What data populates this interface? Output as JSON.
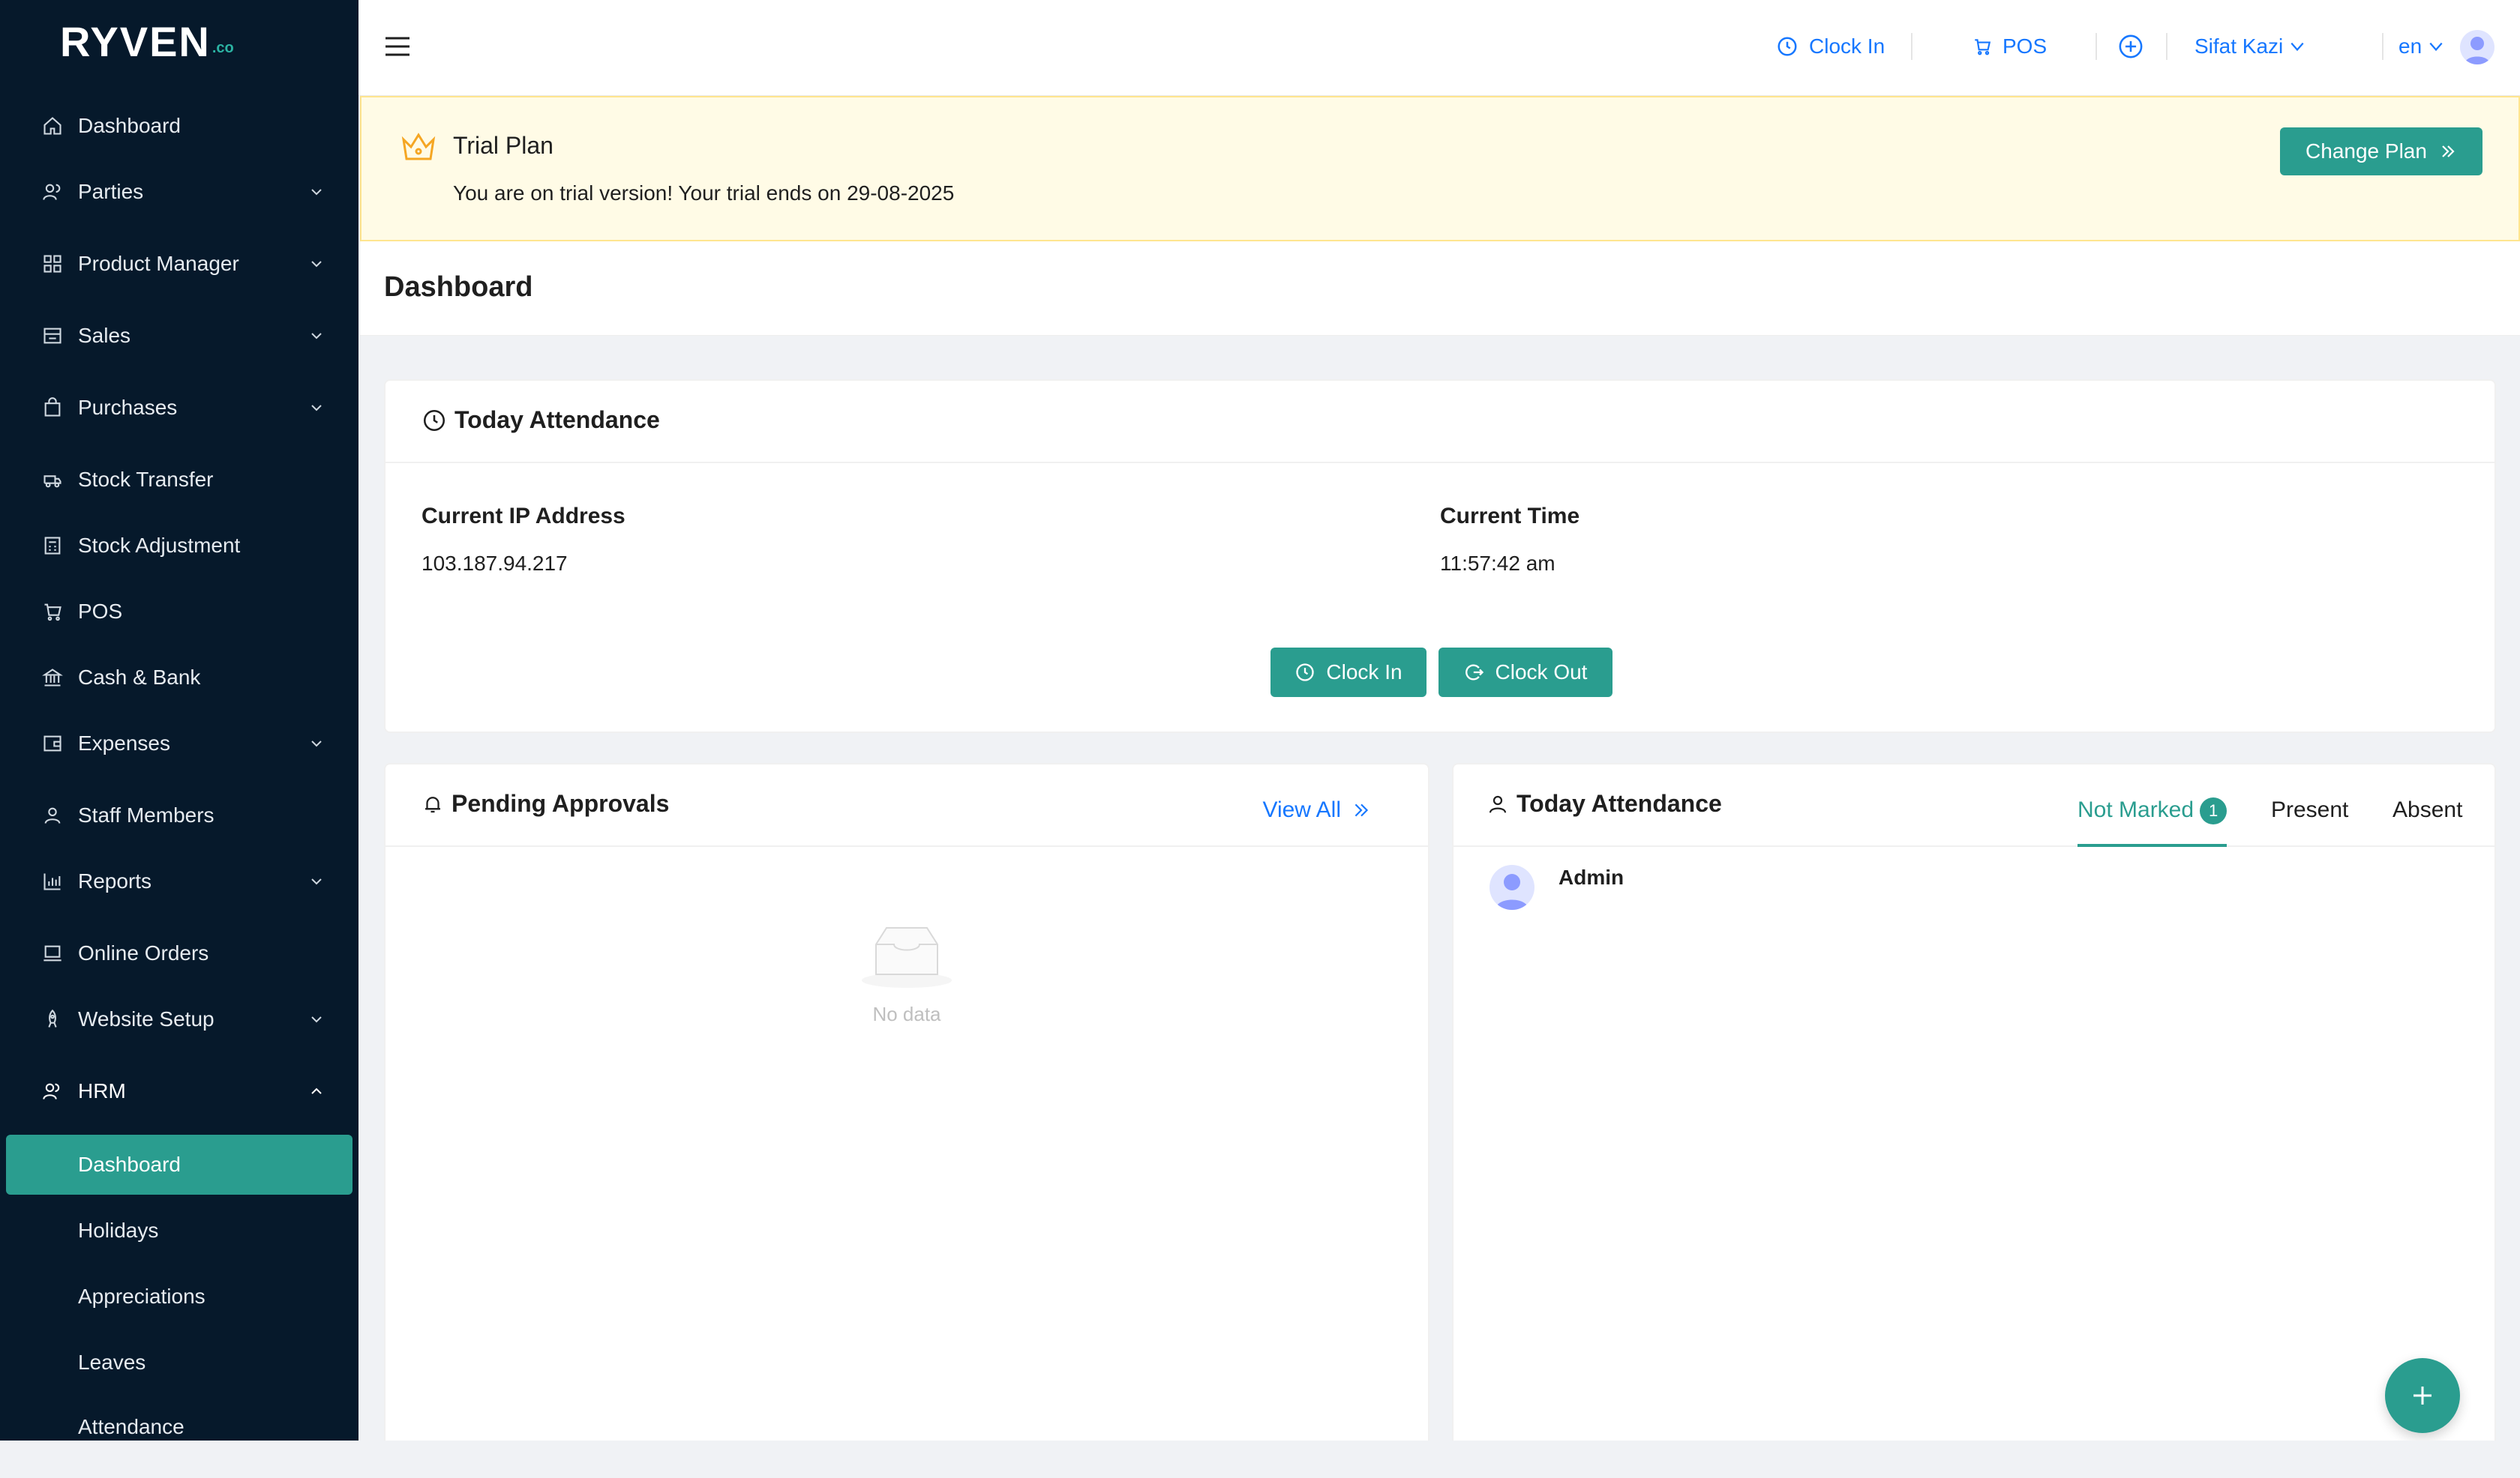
{
  "app": {
    "logo_text": "RYVEN",
    "logo_suffix": ".co"
  },
  "sidebar": {
    "items": [
      {
        "label": "Dashboard",
        "icon": "home-icon",
        "expandable": false
      },
      {
        "label": "Parties",
        "icon": "users-icon",
        "expandable": true
      },
      {
        "label": "Product Manager",
        "icon": "grid-icon",
        "expandable": true
      },
      {
        "label": "Sales",
        "icon": "store-icon",
        "expandable": true
      },
      {
        "label": "Purchases",
        "icon": "bag-icon",
        "expandable": true
      },
      {
        "label": "Stock Transfer",
        "icon": "truck-icon",
        "expandable": false
      },
      {
        "label": "Stock Adjustment",
        "icon": "calculator-icon",
        "expandable": false
      },
      {
        "label": "POS",
        "icon": "cart-icon",
        "expandable": false
      },
      {
        "label": "Cash & Bank",
        "icon": "bank-icon",
        "expandable": false
      },
      {
        "label": "Expenses",
        "icon": "wallet-icon",
        "expandable": true
      },
      {
        "label": "Staff Members",
        "icon": "user-icon",
        "expandable": false
      },
      {
        "label": "Reports",
        "icon": "bar-chart-icon",
        "expandable": true
      },
      {
        "label": "Online Orders",
        "icon": "laptop-icon",
        "expandable": false
      },
      {
        "label": "Website Setup",
        "icon": "rocket-icon",
        "expandable": true
      },
      {
        "label": "HRM",
        "icon": "team-icon",
        "expandable": true,
        "expanded": true
      }
    ],
    "hrm_sub_items": [
      {
        "label": "Dashboard",
        "active": true
      },
      {
        "label": "Holidays"
      },
      {
        "label": "Appreciations"
      },
      {
        "label": "Leaves"
      },
      {
        "label": "Attendance"
      }
    ]
  },
  "topbar": {
    "clock_in_label": "Clock In",
    "pos_label": "POS",
    "user_name": "Sifat Kazi",
    "language": "en"
  },
  "trial": {
    "title": "Trial Plan",
    "message": "You are on trial version! Your trial ends on 29-08-2025",
    "change_plan_label": "Change Plan"
  },
  "page": {
    "title": "Dashboard"
  },
  "attendance_card": {
    "title": "Today Attendance",
    "ip_label": "Current IP Address",
    "ip_value": "103.187.94.217",
    "time_label": "Current Time",
    "time_value": "11:57:42 am",
    "clock_in_label": "Clock In",
    "clock_out_label": "Clock Out"
  },
  "pending_card": {
    "title": "Pending Approvals",
    "view_all_label": "View All",
    "empty_text": "No data"
  },
  "today_attendance_card": {
    "title": "Today Attendance",
    "tabs": [
      {
        "label": "Not Marked",
        "badge": "1",
        "active": true
      },
      {
        "label": "Present"
      },
      {
        "label": "Absent"
      }
    ],
    "rows": [
      {
        "name": "Admin"
      }
    ]
  },
  "colors": {
    "sidebar_bg": "#06192b",
    "accent": "#2a9d8f",
    "link": "#1677ff",
    "trial_bg": "#fffbe6"
  }
}
